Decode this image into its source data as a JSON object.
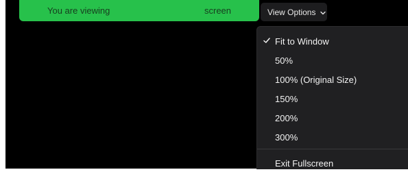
{
  "banner": {
    "viewing_text": "You are viewing",
    "screen_text": "screen",
    "color": "#27c14b"
  },
  "view_options": {
    "label": "View Options",
    "icon": "chevron-down-icon"
  },
  "menu": {
    "items": [
      {
        "label": "Fit to Window",
        "checked": true
      },
      {
        "label": "50%",
        "checked": false
      },
      {
        "label": "100% (Original Size)",
        "checked": false
      },
      {
        "label": "150%",
        "checked": false
      },
      {
        "label": "200%",
        "checked": false
      },
      {
        "label": "300%",
        "checked": false
      }
    ],
    "exit_label": "Exit Fullscreen",
    "check_icon": "checkmark-icon"
  }
}
